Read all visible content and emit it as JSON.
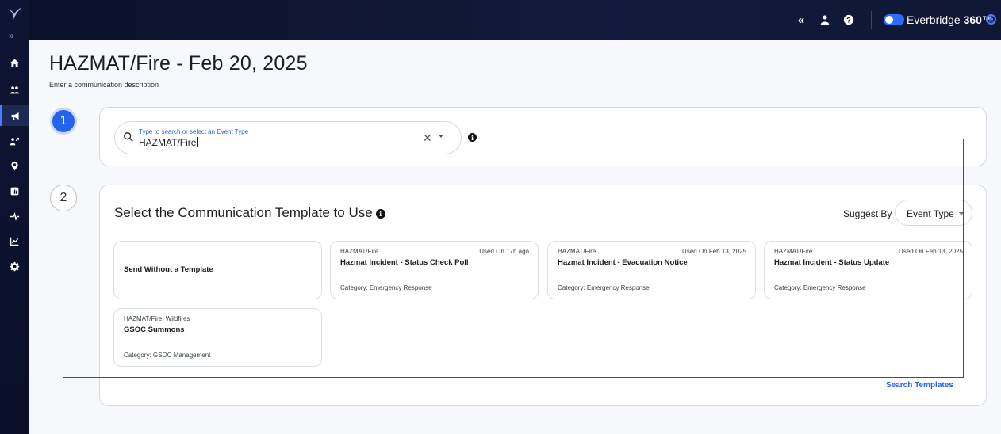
{
  "colors": {
    "accent": "#2463eb",
    "nav_bg": "#0d1535",
    "highlight": "#c0162c"
  },
  "rail": {
    "expand_glyph": "»",
    "items": [
      {
        "name": "home-icon"
      },
      {
        "name": "contacts-icon"
      },
      {
        "name": "megaphone-icon",
        "active": true
      },
      {
        "name": "incidents-icon"
      },
      {
        "name": "location-pin-icon"
      },
      {
        "name": "reports-icon"
      },
      {
        "name": "integrations-icon"
      },
      {
        "name": "analytics-icon"
      },
      {
        "name": "settings-gear-icon"
      }
    ]
  },
  "topbar": {
    "collapse_glyph": "«",
    "brand_name": "Everbridge",
    "brand_suffix": "360™"
  },
  "page": {
    "title": "HAZMAT/Fire - Feb 20, 2025",
    "description": "Enter a communication description"
  },
  "steps": [
    "1",
    "2"
  ],
  "event_type": {
    "placeholder": "Type to search or select an Event Type",
    "value": "HAZMAT/Fire"
  },
  "templates_section": {
    "title": "Select the Communication Template to Use",
    "suggest_label": "Suggest By",
    "suggest_value": "Event Type",
    "search_link": "Search Templates",
    "no_template_label": "Send Without a Template",
    "cards": [
      {
        "tags": "HAZMAT/Fire",
        "used": "Used On 17h ago",
        "name": "Hazmat Incident - Status Check Poll",
        "category": "Category: Emergency Response"
      },
      {
        "tags": "HAZMAT/Fire",
        "used": "Used On Feb 13, 2025",
        "name": "Hazmat Incident - Evacuation Notice",
        "category": "Category: Emergency Response"
      },
      {
        "tags": "HAZMAT/Fire",
        "used": "Used On Feb 13, 2025",
        "name": "Hazmat Incident - Status Update",
        "category": "Category: Emergency Response"
      },
      {
        "tags": "HAZMAT/Fire, Wildfires",
        "used": "",
        "name": "GSOC Summons",
        "category": "Category: GSOC Management"
      }
    ]
  }
}
